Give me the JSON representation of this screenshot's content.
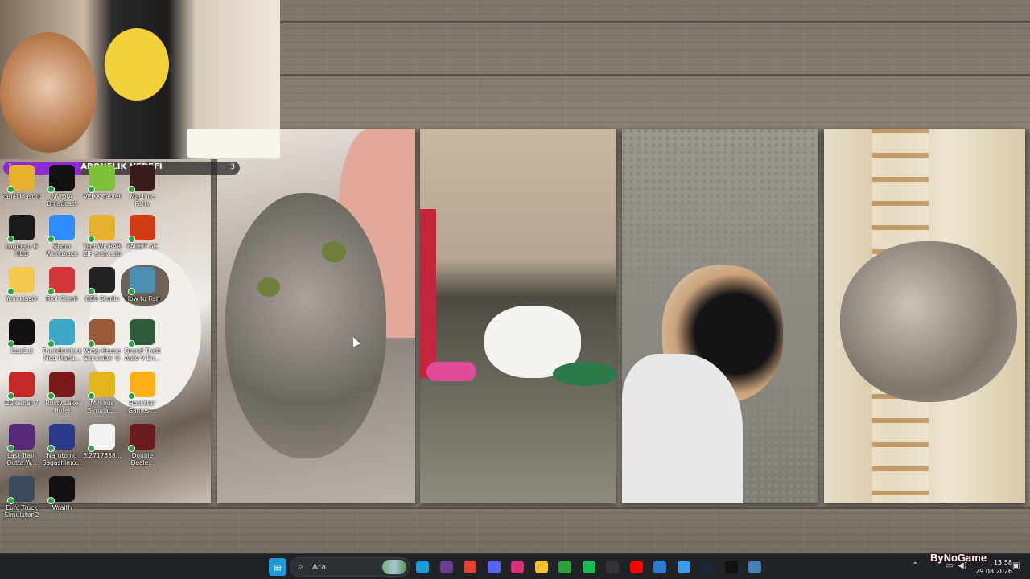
{
  "webcam": {
    "subscription_goal": {
      "title": "ABONELIK HEDEFI",
      "current": "1",
      "target": "3",
      "progress": 0.33
    }
  },
  "desktop_icons": [
    {
      "label": "kanal klasörü",
      "icon": "folder-icon",
      "color": "#e6b12c"
    },
    {
      "label": "NVIDIA Broadcast",
      "icon": "nvidia-icon",
      "color": "#111111"
    },
    {
      "label": "VEIKK Tablet",
      "icon": "veikk-icon",
      "color": "#7ec13b"
    },
    {
      "label": "Machine Party",
      "icon": "machine-party-icon",
      "color": "#3a1c1c"
    },
    {
      "label": "Logitech G HUB",
      "icon": "logitech-icon",
      "color": "#1a1a1a"
    },
    {
      "label": "Zoom Workplace",
      "icon": "zoom-icon",
      "color": "#2d8cff"
    },
    {
      "label": "Yeni WinRAR ZIP arşivi.zip",
      "icon": "winrar-folder-icon",
      "color": "#e6b12c"
    },
    {
      "label": "FACEIT AC",
      "icon": "faceit-icon",
      "color": "#d13a13"
    },
    {
      "label": "Yeni klasör",
      "icon": "folder-icon",
      "color": "#f2c94c"
    },
    {
      "label": "Riot Client",
      "icon": "riot-icon",
      "color": "#d13639"
    },
    {
      "label": "OBS Studio",
      "icon": "obs-icon",
      "color": "#222222"
    },
    {
      "label": "How to Fish",
      "icon": "how-to-fish-icon",
      "color": "#4c8fb3"
    },
    {
      "label": "CapCut",
      "icon": "capcut-icon",
      "color": "#111111"
    },
    {
      "label": "Thunderstore Mod Mana...",
      "icon": "thunderstore-icon",
      "color": "#3aa8c6"
    },
    {
      "label": "Wrap House Simulator ©",
      "icon": "wrap-house-icon",
      "color": "#9a5a3a"
    },
    {
      "label": "Grand Theft Auto V En...",
      "icon": "gta-icon",
      "color": "#2f5d3b"
    },
    {
      "label": "CCleaner 7",
      "icon": "ccleaner-icon",
      "color": "#c62828"
    },
    {
      "label": "Rusty Lake Hotel",
      "icon": "rusty-lake-icon",
      "color": "#7a1a1a"
    },
    {
      "label": "Minibus Simulat...",
      "icon": "minibus-icon",
      "color": "#e2b51c"
    },
    {
      "label": "Rockstar Games ...",
      "icon": "rockstar-icon",
      "color": "#fcaf17"
    },
    {
      "label": "Last Train Outta W...",
      "icon": "last-train-icon",
      "color": "#5a2a7a"
    },
    {
      "label": "Naruto no Sagashimo...",
      "icon": "naruto-icon",
      "color": "#2a3a8a"
    },
    {
      "label": "6.2717538...",
      "icon": "document-icon",
      "color": "#f3f3f3"
    },
    {
      "label": "Double Deale...",
      "icon": "double-dealer-icon",
      "color": "#6b1d1d"
    },
    {
      "label": "Euro Truck Simulator 2",
      "icon": "euro-truck-icon",
      "color": "#3a4a5a"
    },
    {
      "label": "Wraith",
      "icon": "wraith-icon",
      "color": "#111111"
    }
  ],
  "taskbar": {
    "search_placeholder": "Ara",
    "pinned": [
      {
        "icon": "edge-icon",
        "color": "#1e9bd7"
      },
      {
        "icon": "visual-studio-icon",
        "color": "#6a3e8e"
      },
      {
        "icon": "chrome-icon",
        "color": "#e34133"
      },
      {
        "icon": "discord-icon",
        "color": "#5865f2"
      },
      {
        "icon": "instagram-icon",
        "color": "#d6307a"
      },
      {
        "icon": "file-explorer-icon",
        "color": "#f2c230"
      },
      {
        "icon": "xbox-icon",
        "color": "#2f9e3b"
      },
      {
        "icon": "spotify-icon",
        "color": "#1db954"
      },
      {
        "icon": "recording-icon",
        "color": "#333333"
      },
      {
        "icon": "youtube-icon",
        "color": "#ff0000"
      },
      {
        "icon": "mail-icon",
        "color": "#2b7cd3"
      },
      {
        "icon": "notepad-icon",
        "color": "#3d9be9"
      },
      {
        "icon": "steam-icon",
        "color": "#1b2838"
      },
      {
        "icon": "tiktok-icon",
        "color": "#111111"
      },
      {
        "icon": "settings-app-icon",
        "color": "#4a7fb5"
      }
    ],
    "time": "13:58",
    "date": "29.08.2026",
    "watermark": "ByNoGame"
  }
}
